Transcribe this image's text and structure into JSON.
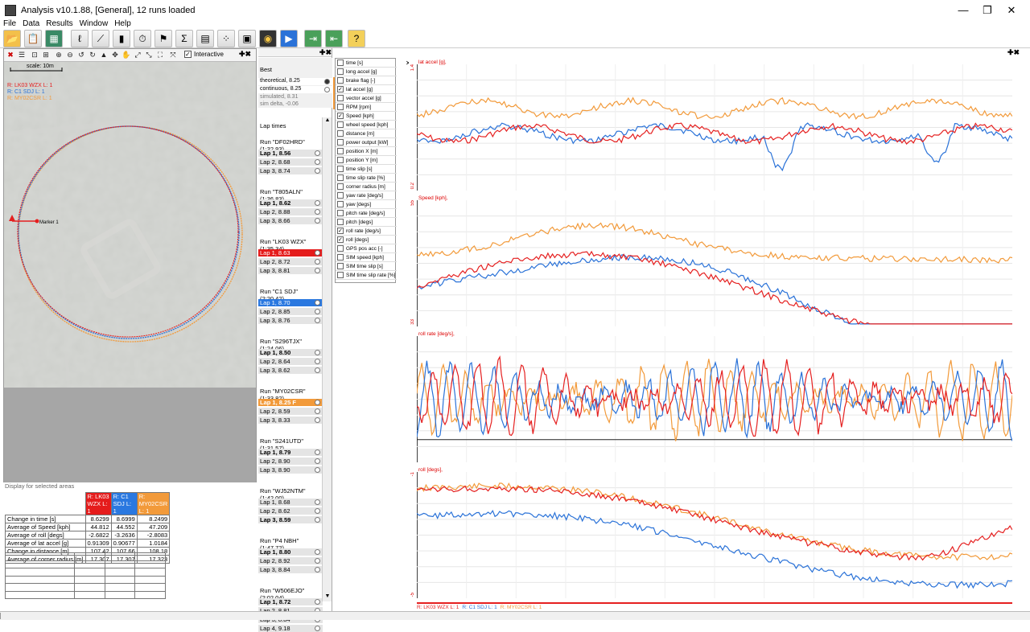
{
  "window": {
    "title": "Analysis v10.1.88, [General], 12 runs loaded"
  },
  "window_controls": {
    "minimize": "—",
    "maximize": "❐",
    "close": "✕"
  },
  "menu": [
    "File",
    "Data",
    "Results",
    "Window",
    "Help"
  ],
  "toolbar": {
    "icons": [
      "open-folder-icon",
      "document-icon",
      "load-run-icon",
      "track-icon",
      "xy-graph-icon",
      "bar-chart-icon",
      "stopwatch-icon",
      "checkered-flag-icon",
      "formula-icon",
      "grid-chart-icon",
      "scatter-icon",
      "video-icon",
      "gauge-icon",
      "play-icon",
      "export-icon",
      "import-icon",
      "help-icon"
    ]
  },
  "map": {
    "scale_label": "scale: 10m",
    "interactive_label": "Interactive",
    "interactive_checked": true,
    "run_labels": [
      {
        "text": "R: LK03 WZX L: 1",
        "color": "#e52020"
      },
      {
        "text": "R: C1 SDJ L: 1",
        "color": "#2a72d8"
      },
      {
        "text": "R: MY02CSR L: 1",
        "color": "#f29a3a"
      }
    ],
    "marker_label": "Marker 1"
  },
  "selection": {
    "title": "Display for selected areas",
    "columns": [
      {
        "text": "R: LK03 WZX L: 1",
        "color": "#e51c1c"
      },
      {
        "text": "R: C1 SDJ L: 1",
        "color": "#2a78e0"
      },
      {
        "text": "R: MY02CSR L: 1",
        "color": "#f29a3a"
      }
    ],
    "rows": [
      {
        "label": "Change in time [s]",
        "values": [
          "8.6299",
          "8.6999",
          "8.2499"
        ]
      },
      {
        "label": "Average of Speed [kph]",
        "values": [
          "44.812",
          "44.552",
          "47.209"
        ]
      },
      {
        "label": "Average of roll [degs]",
        "values": [
          "-2.6822",
          "-3.2636",
          "-2.8083"
        ]
      },
      {
        "label": "Average of lat accel [g]",
        "values": [
          "0.91309",
          "0.90677",
          "1.0184"
        ]
      },
      {
        "label": "Change in distance [m]",
        "values": [
          "107.42",
          "107.66",
          "108.18"
        ]
      },
      {
        "label": "Average of corner radius [m]",
        "values": [
          "17.307",
          "17.307",
          "17.323"
        ]
      }
    ]
  },
  "best": {
    "title": "Best",
    "items": [
      "theoretical, 8.25",
      "continuous, 8.25",
      "simulated, 8.31",
      "sim delta, -0.06"
    ]
  },
  "laps": {
    "title": "Lap times",
    "runs": [
      {
        "name": "Run \"DF02HRD\" (1:32.93)",
        "laps": [
          {
            "t": "Lap 1, 8.56",
            "bold": true
          },
          {
            "t": "Lap 2, 8.68"
          },
          {
            "t": "Lap 3, 8.74"
          }
        ]
      },
      {
        "name": "Run \"T805ALN\" (1:36.83)",
        "laps": [
          {
            "t": "Lap 1, 8.62",
            "bold": true
          },
          {
            "t": "Lap 2, 8.88"
          },
          {
            "t": "Lap 3, 8.66"
          }
        ]
      },
      {
        "name": "Run \"LK03 WZX\" (1:35.34)",
        "laps": [
          {
            "t": "Lap 1, 8.63",
            "hl": "#e51c1c"
          },
          {
            "t": "Lap 2, 8.72"
          },
          {
            "t": "Lap 3, 8.81"
          }
        ]
      },
      {
        "name": "Run \"C1 SDJ\" (2:20.42)",
        "laps": [
          {
            "t": "Lap 1, 8.70",
            "hl": "#2a78e0"
          },
          {
            "t": "Lap 2, 8.85"
          },
          {
            "t": "Lap 3, 8.76"
          }
        ]
      },
      {
        "name": "Run \"S296TJX\" (1:24.06)",
        "laps": [
          {
            "t": "Lap 1, 8.50",
            "bold": true
          },
          {
            "t": "Lap 2, 8.64"
          },
          {
            "t": "Lap 3, 8.62"
          }
        ]
      },
      {
        "name": "Run \"MY02CSR\" (1:33.82)",
        "laps": [
          {
            "t": "Lap 1, 8.25 F",
            "hl": "#f29a3a",
            "bold": true
          },
          {
            "t": "Lap 2, 8.59"
          },
          {
            "t": "Lap 3, 8.33"
          }
        ]
      },
      {
        "name": "Run \"S241UTD\" (1:31.57)",
        "laps": [
          {
            "t": "Lap 1, 8.79",
            "bold": true
          },
          {
            "t": "Lap 2, 8.90"
          },
          {
            "t": "Lap 3, 8.90"
          }
        ]
      },
      {
        "name": "Run \"WJ52NTM\" (1:42.00)",
        "laps": [
          {
            "t": "Lap 1, 8.68"
          },
          {
            "t": "Lap 2, 8.62"
          },
          {
            "t": "Lap 3, 8.59",
            "bold": true
          }
        ]
      },
      {
        "name": "Run \"P4 NBH\" (1:47.72)",
        "laps": [
          {
            "t": "Lap 1, 8.80",
            "bold": true
          },
          {
            "t": "Lap 2, 8.92"
          },
          {
            "t": "Lap 3, 8.84"
          }
        ]
      },
      {
        "name": "Run \"W506EJO\" (2:02.04)",
        "laps": [
          {
            "t": "Lap 1, 8.72",
            "bold": true
          },
          {
            "t": "Lap 2, 8.81"
          },
          {
            "t": "Lap 3, 8.84"
          },
          {
            "t": "Lap 4, 9.18"
          }
        ]
      }
    ]
  },
  "channels": [
    {
      "name": "time [s]",
      "on": false
    },
    {
      "name": "long accel [g]",
      "on": false
    },
    {
      "name": "brake flag [-]",
      "on": false
    },
    {
      "name": "lat accel [g]",
      "on": true
    },
    {
      "name": "vector accel [g]",
      "on": false
    },
    {
      "name": "RPM [rpm]",
      "on": false
    },
    {
      "name": "Speed [kph]",
      "on": true
    },
    {
      "name": "wheel speed [kph]",
      "on": false
    },
    {
      "name": "distance [m]",
      "on": false
    },
    {
      "name": "power output [kW]",
      "on": false
    },
    {
      "name": "position X [m]",
      "on": false
    },
    {
      "name": "position Y [m]",
      "on": false
    },
    {
      "name": "time slip [s]",
      "on": false
    },
    {
      "name": "time slip rate [%]",
      "on": false
    },
    {
      "name": "corner radius [m]",
      "on": false
    },
    {
      "name": "yaw rate [deg/s]",
      "on": false
    },
    {
      "name": "yaw [degs]",
      "on": false
    },
    {
      "name": "pitch rate [deg/s]",
      "on": false
    },
    {
      "name": "pitch [degs]",
      "on": false
    },
    {
      "name": "roll rate [deg/s]",
      "on": true
    },
    {
      "name": "roll [degs]",
      "on": true
    },
    {
      "name": "GPS pos acc [-]",
      "on": false
    },
    {
      "name": "SIM speed [kph]",
      "on": false
    },
    {
      "name": "SIM time slip [s]",
      "on": false
    },
    {
      "name": "SIM time slip rate [%]",
      "on": false
    }
  ],
  "graphs": [
    {
      "title": "lat accel [g],",
      "ymax": "1.4",
      "ymin": "0.2"
    },
    {
      "title": "Speed [kph],",
      "ymax": "55",
      "ymin": "33"
    },
    {
      "title": "roll rate [deg/s],",
      "ymax": "",
      "ymin": ""
    },
    {
      "title": "roll [degs],",
      "ymax": "-1",
      "ymin": "-5"
    }
  ],
  "legend": [
    {
      "text": "R: LK03 WZX L: 1",
      "color": "#e52020"
    },
    {
      "text": "R: C1 SDJ L: 1",
      "color": "#2a72d8"
    },
    {
      "text": "R: MY02CSR L: 1",
      "color": "#f29a3a"
    }
  ],
  "colors": {
    "red": "#e52020",
    "blue": "#2a72d8",
    "orange": "#f29a3a",
    "accent_green": "#2ea62e"
  }
}
